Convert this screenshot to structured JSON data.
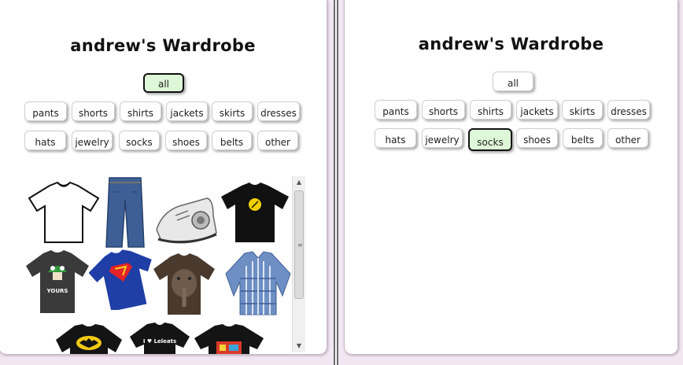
{
  "left_panel": {
    "title": "andrew's Wardrobe",
    "categories": [
      "all",
      "pants",
      "shorts",
      "shirts",
      "jackets",
      "skirts",
      "dresses",
      "hats",
      "jewelry",
      "socks",
      "shoes",
      "belts",
      "other"
    ],
    "selected": "all",
    "items": [
      {
        "name": "white t-shirt"
      },
      {
        "name": "blue jeans"
      },
      {
        "name": "sneaker"
      },
      {
        "name": "black t-shirt yellow logo"
      },
      {
        "name": "mushroom t-shirt",
        "text": "YOURS"
      },
      {
        "name": "superman t-shirt"
      },
      {
        "name": "elephant t-shirt"
      },
      {
        "name": "plaid button shirt"
      },
      {
        "name": "batman t-shirt"
      },
      {
        "name": "leleats t-shirt",
        "text": "I ♥ Leleats"
      },
      {
        "name": "colorful print t-shirt"
      }
    ]
  },
  "right_panel": {
    "title": "andrew's Wardrobe",
    "categories": [
      "all",
      "pants",
      "shorts",
      "shirts",
      "jackets",
      "skirts",
      "dresses",
      "hats",
      "jewelry",
      "socks",
      "shoes",
      "belts",
      "other"
    ],
    "selected": "socks"
  },
  "colors": {
    "background": "#f3e6f3",
    "selected_button": "#dff7d9",
    "button_border": "#cfcfcf"
  }
}
